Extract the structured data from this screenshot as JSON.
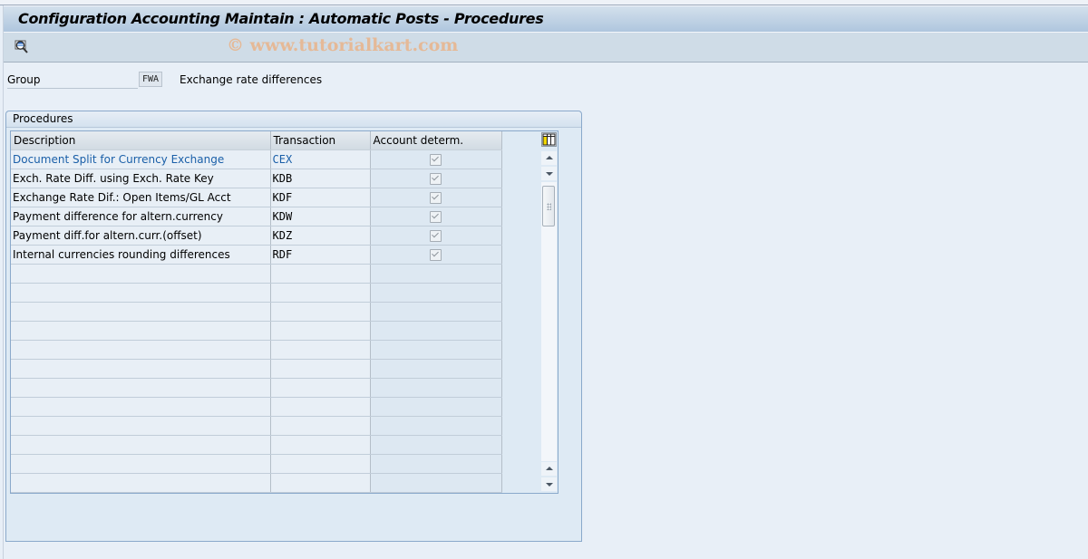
{
  "window": {
    "title": "Configuration Accounting Maintain : Automatic Posts - Procedures",
    "watermark": "© www.tutorialkart.com"
  },
  "toolbar": {
    "buttons": [
      {
        "icon": "display-detail-icon",
        "label": ""
      }
    ]
  },
  "header_fields": {
    "group_label": "Group",
    "group_value": "FWA",
    "group_description": "Exchange rate differences"
  },
  "procedures": {
    "title": "Procedures",
    "columns": [
      "Description",
      "Transaction",
      "Account determ."
    ],
    "rows": [
      {
        "description": "Document Split for Currency Exchange",
        "transaction": "CEX",
        "account_determ": true,
        "highlighted": true
      },
      {
        "description": "Exch. Rate Diff. using Exch. Rate Key",
        "transaction": "KDB",
        "account_determ": true
      },
      {
        "description": "Exchange Rate Dif.: Open Items/GL Acct",
        "transaction": "KDF",
        "account_determ": true
      },
      {
        "description": "Payment difference for altern.currency",
        "transaction": "KDW",
        "account_determ": true
      },
      {
        "description": "Payment diff.for altern.curr.(offset)",
        "transaction": "KDZ",
        "account_determ": true
      },
      {
        "description": "Internal currencies rounding differences",
        "transaction": "RDF",
        "account_determ": true
      }
    ],
    "empty_rows": 12,
    "table_settings_icon": "column-settings-icon"
  },
  "colors": {
    "link_text": "#1a5fa8",
    "title_bar_top": "#d3e0ec",
    "title_bar_bottom": "#afc6de",
    "background": "#e8eff7"
  }
}
